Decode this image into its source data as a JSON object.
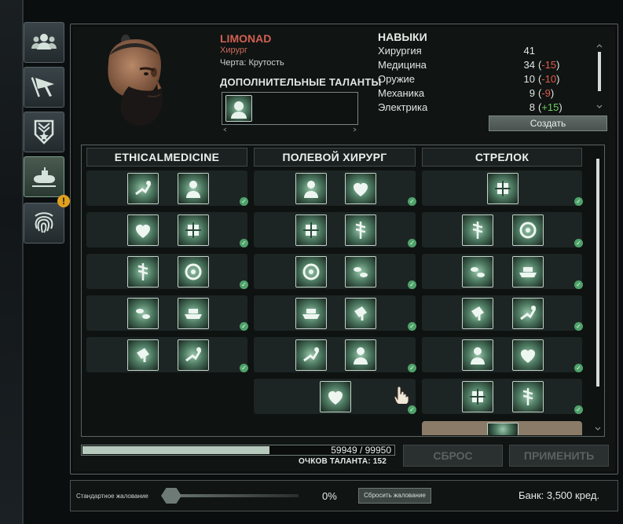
{
  "colors": {
    "name": "#d06050",
    "negative": "#e05a4a",
    "positive": "#6fce64",
    "check": "#4fa26a",
    "alert": "#e0a020"
  },
  "sidebar": {
    "tabs": [
      {
        "icon": "crew-icon"
      },
      {
        "icon": "flag-icon"
      },
      {
        "icon": "rank-badge-icon"
      },
      {
        "icon": "submarine-icon"
      },
      {
        "icon": "fingerprint-icon"
      }
    ],
    "alert_text": "!"
  },
  "character": {
    "name": "LIMONAD",
    "job": "Хирург",
    "trait": "Черта: Крутость",
    "extra_talents_title": "ДОПОЛНИТЕЛЬНЫЕ ТАЛАНТЫ"
  },
  "skills": {
    "title": "НАВЫКИ",
    "items": [
      {
        "name": "Хирургия",
        "value": "41",
        "mod": "",
        "mod_sign": ""
      },
      {
        "name": "Медицина",
        "value": "34",
        "mod": "-15",
        "mod_sign": "neg"
      },
      {
        "name": "Оружие",
        "value": "10",
        "mod": "-10",
        "mod_sign": "neg"
      },
      {
        "name": "Механика",
        "value": "9",
        "mod": "-9",
        "mod_sign": "neg"
      },
      {
        "name": "Электрика",
        "value": "8",
        "mod": "+15",
        "mod_sign": "pos"
      }
    ],
    "create_label": "Создать"
  },
  "tree": {
    "columns": [
      {
        "title": "ETHICALMEDICINE",
        "rows": [
          2,
          2,
          2,
          2,
          2
        ]
      },
      {
        "title": "ПОЛЕВОЙ ХИРУРГ",
        "rows": [
          2,
          2,
          2,
          2,
          2,
          1
        ]
      },
      {
        "title": "СТРЕЛОК",
        "rows": [
          1,
          2,
          2,
          2,
          2,
          2
        ]
      }
    ]
  },
  "progress": {
    "current": 59949,
    "max": 99950,
    "text": "59949 / 99950",
    "label": "ОЧКОВ ТАЛАНТА: 152"
  },
  "actions": {
    "reset": "СБРОС",
    "apply": "ПРИМЕНИТЬ"
  },
  "footer": {
    "salary_label": "Стандартное жалование",
    "salary_percent": "0%",
    "salary_reset": "Сбросить жалование",
    "bank": "Банк: 3,500 кред."
  }
}
